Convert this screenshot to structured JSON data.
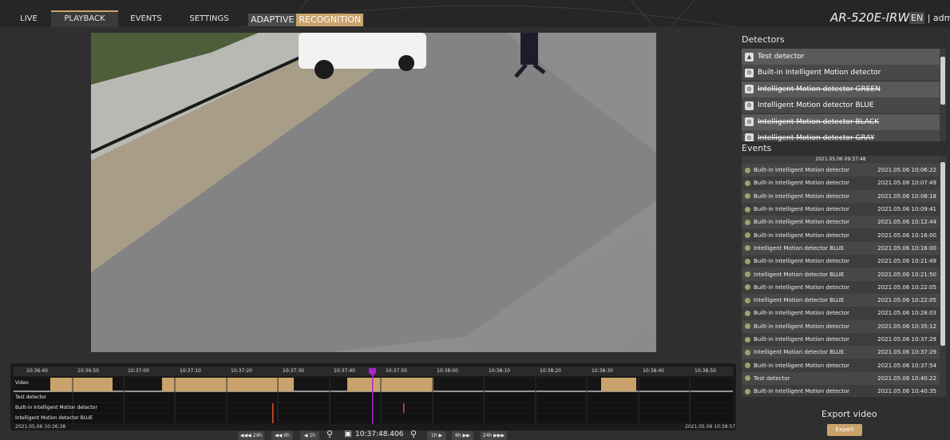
{
  "nav": {
    "tabs": [
      {
        "label": "LIVE"
      },
      {
        "label": "PLAYBACK"
      },
      {
        "label": "EVENTS"
      },
      {
        "label": "SETTINGS"
      }
    ],
    "active_tab": "PLAYBACK",
    "adaptive": "ADAPTIVE",
    "recognition": "RECOGNITION",
    "model": "AR-520E-IRW",
    "lang": "EN",
    "separator": "|",
    "user": "admin"
  },
  "detectors": {
    "title": "Detectors",
    "items": [
      {
        "label": "Test detector",
        "icon": "person-icon",
        "struck": false
      },
      {
        "label": "Built-in Intelligent Motion detector",
        "icon": "motion-icon",
        "struck": false
      },
      {
        "label": "Intelligent Motion detector GREEN",
        "icon": "motion-icon",
        "struck": true
      },
      {
        "label": "Intelligent Motion detector BLUE",
        "icon": "motion-icon",
        "struck": false
      },
      {
        "label": "Intelligent Motion detector BLACK",
        "icon": "motion-icon",
        "struck": true
      },
      {
        "label": "Intelligent Motion detector GRAY",
        "icon": "motion-icon",
        "struck": true
      }
    ]
  },
  "events": {
    "title": "Events",
    "header_date": "2021.05.06 09:37:48",
    "rows": [
      {
        "name": "Built-in Intelligent Motion detector",
        "time": "2021.05.06 10:06:22"
      },
      {
        "name": "Built-in Intelligent Motion detector",
        "time": "2021.05.06 10:07:49"
      },
      {
        "name": "Built-in Intelligent Motion detector",
        "time": "2021.05.06 10:08:18"
      },
      {
        "name": "Built-in Intelligent Motion detector",
        "time": "2021.05.06 10:09:41"
      },
      {
        "name": "Built-in Intelligent Motion detector",
        "time": "2021.05.06 10:12:44"
      },
      {
        "name": "Built-in Intelligent Motion detector",
        "time": "2021.05.06 10:16:00"
      },
      {
        "name": "Intelligent Motion detector BLUE",
        "time": "2021.05.06 10:16:00"
      },
      {
        "name": "Built-in Intelligent Motion detector",
        "time": "2021.05.06 10:21:49"
      },
      {
        "name": "Intelligent Motion detector BLUE",
        "time": "2021.05.06 10:21:50"
      },
      {
        "name": "Built-in Intelligent Motion detector",
        "time": "2021.05.06 10:22:05"
      },
      {
        "name": "Intelligent Motion detector BLUE",
        "time": "2021.05.06 10:22:05"
      },
      {
        "name": "Built-in Intelligent Motion detector",
        "time": "2021.05.06 10:28:03"
      },
      {
        "name": "Built-in Intelligent Motion detector",
        "time": "2021.05.06 10:35:12"
      },
      {
        "name": "Built-in Intelligent Motion detector",
        "time": "2021.05.06 10:37:29"
      },
      {
        "name": "Intelligent Motion detector BLUE",
        "time": "2021.05.06 10:37:29"
      },
      {
        "name": "Built-in Intelligent Motion detector",
        "time": "2021.05.06 10:37:54"
      },
      {
        "name": "Test detector",
        "time": "2021.05.06 10:40:22"
      },
      {
        "name": "Built-in Intelligent Motion detector",
        "time": "2021.05.06 10:40:35"
      }
    ]
  },
  "export": {
    "title": "Export video",
    "button": "Export"
  },
  "timeline": {
    "ticks": [
      "10:36:40",
      "10:36:50",
      "10:37:00",
      "10:37:10",
      "10:37:20",
      "10:37:30",
      "10:37:40",
      "10:37:50",
      "10:38:00",
      "10:38:10",
      "10:38:20",
      "10:38:30",
      "10:38:40",
      "10:38:50"
    ],
    "rows": [
      "Video",
      "Test detector",
      "Built-in Intelligent Motion detector",
      "Intelligent Motion detector BLUE"
    ],
    "start": "2021.05.06 10:36:38",
    "end": "2021.05.06 10:38:57",
    "current_time": "10:37:48.406",
    "buttons": {
      "back24": "24h",
      "back6": "6h",
      "back1": "1h",
      "fwd1": "1h",
      "fwd6": "6h",
      "fwd24": "24h"
    }
  },
  "colors": {
    "accent": "#c9a36b",
    "event_dot": "#9aa56a",
    "playhead": "#b01fd0",
    "event_mark": "#e0502a"
  }
}
